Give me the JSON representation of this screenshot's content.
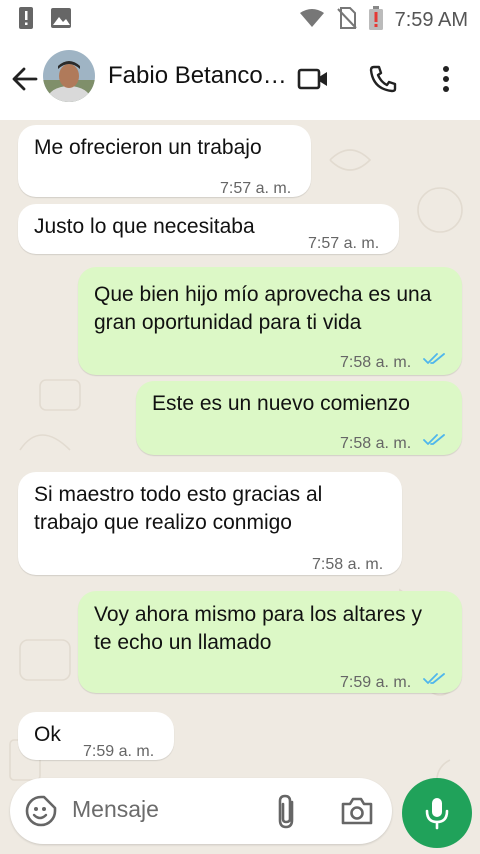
{
  "status_bar": {
    "time": "7:59 AM"
  },
  "header": {
    "contact_name": "Fabio Betancourt"
  },
  "messages": [
    {
      "direction": "in",
      "text": "Me ofrecieron un trabajo",
      "time": "7:57 a. m."
    },
    {
      "direction": "in",
      "text": "Justo lo que necesitaba",
      "time": "7:57 a. m."
    },
    {
      "direction": "out",
      "text": "Que bien hijo mío aprovecha es una gran oportunidad para ti vida",
      "time": "7:58 a. m.",
      "read": true
    },
    {
      "direction": "out",
      "text": "Este es un nuevo comienzo",
      "time": "7:58 a. m.",
      "read": true
    },
    {
      "direction": "in",
      "text": "Si maestro todo esto gracias al trabajo que realizo conmigo",
      "time": "7:58 a. m."
    },
    {
      "direction": "out",
      "text": "Voy ahora mismo para los altares y te echo un llamado",
      "time": "7:59 a. m.",
      "read": true
    },
    {
      "direction": "in",
      "text": "Ok",
      "time": "7:59 a. m."
    }
  ],
  "input": {
    "placeholder": "Mensaje"
  },
  "colors": {
    "accent": "#20a25a",
    "outgoing_bubble": "#dcf8c6",
    "incoming_bubble": "#ffffff",
    "read_ticks": "#4fb6ec"
  },
  "icons": [
    "warning-icon",
    "image-icon",
    "wifi-icon",
    "no-sim-icon",
    "battery-alert-icon",
    "back-arrow-icon",
    "video-call-icon",
    "phone-icon",
    "more-options-icon",
    "sticker-icon",
    "attach-icon",
    "camera-icon",
    "microphone-icon"
  ]
}
